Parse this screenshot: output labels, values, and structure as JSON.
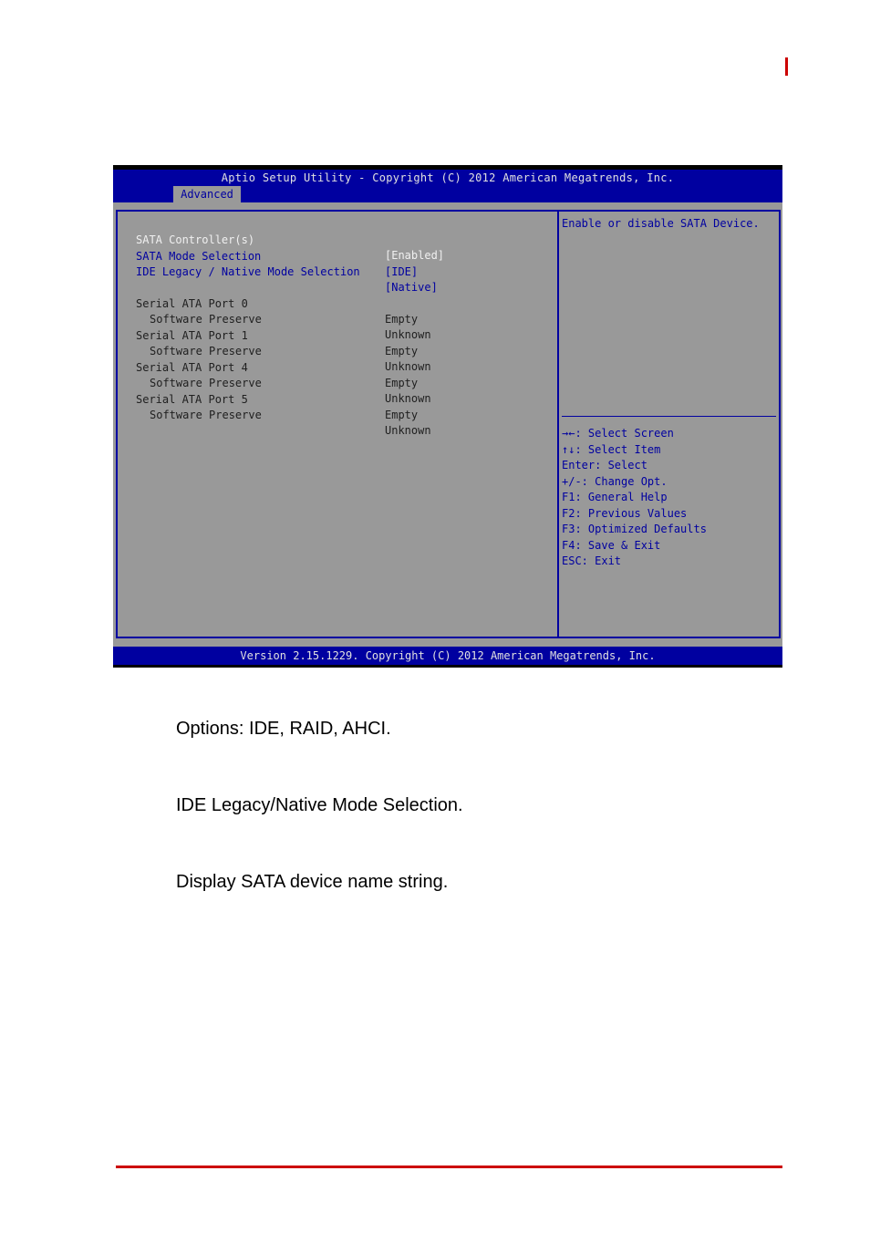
{
  "page": {
    "accent_color": "#cc0000"
  },
  "bios": {
    "title": "Aptio Setup Utility - Copyright (C) 2012 American Megatrends, Inc.",
    "active_tab": "Advanced",
    "colors": {
      "bar": "#0000a0",
      "panel": "#999999"
    },
    "settings": [
      {
        "label": "SATA Controller(s)",
        "value": "[Enabled]"
      },
      {
        "label": "SATA Mode Selection",
        "value": "[IDE]"
      },
      {
        "label": "IDE Legacy / Native Mode Selection",
        "value": "[Native]"
      }
    ],
    "ports": [
      {
        "label": "Serial ATA Port 0",
        "value": "Empty"
      },
      {
        "label": "Software Preserve",
        "value": "Unknown"
      },
      {
        "label": "Serial ATA Port 1",
        "value": "Empty"
      },
      {
        "label": "Software Preserve",
        "value": "Unknown"
      },
      {
        "label": "Serial ATA Port 4",
        "value": "Empty"
      },
      {
        "label": "Software Preserve",
        "value": "Unknown"
      },
      {
        "label": "Serial ATA Port 5",
        "value": "Empty"
      },
      {
        "label": "Software Preserve",
        "value": "Unknown"
      }
    ],
    "help_text": "Enable or disable SATA Device.",
    "keys": [
      "→←: Select Screen",
      "↑↓: Select Item",
      "Enter: Select",
      "+/-: Change Opt.",
      "F1: General Help",
      "F2: Previous Values",
      "F3: Optimized Defaults",
      "F4: Save & Exit",
      "ESC: Exit"
    ],
    "footer": "Version 2.15.1229. Copyright (C) 2012 American Megatrends, Inc."
  },
  "descriptions": [
    "Options: IDE, RAID, AHCI.",
    "IDE Legacy/Native Mode Selection.",
    "Display SATA device name string."
  ]
}
